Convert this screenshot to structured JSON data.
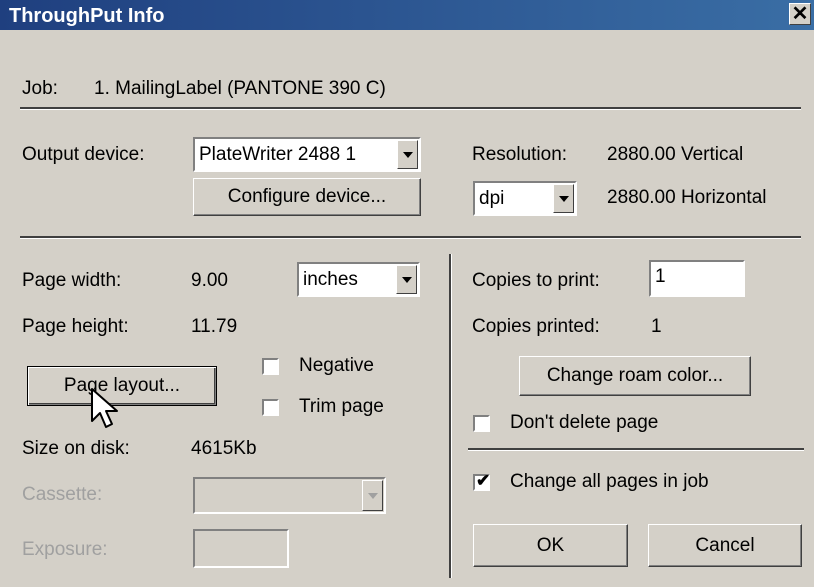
{
  "window": {
    "title": "ThroughPut Info"
  },
  "job": {
    "label": "Job:",
    "value": "1. MailingLabel (PANTONE 390 C)"
  },
  "output": {
    "label": "Output device:",
    "device": "PlateWriter 2488 1",
    "configure_label": "Configure device..."
  },
  "resolution": {
    "label": "Resolution:",
    "vertical": "2880.00 Vertical",
    "horizontal": "2880.00 Horizontal",
    "unit": "dpi"
  },
  "page": {
    "width_label": "Page width:",
    "width_value": "9.00",
    "unit": "inches",
    "height_label": "Page height:",
    "height_value": "11.79",
    "layout_label": "Page layout...",
    "negative_label": "Negative",
    "negative_checked": false,
    "trim_label": "Trim page",
    "trim_checked": false,
    "size_label": "Size on disk:",
    "size_value": "4615Kb",
    "cassette_label": "Cassette:",
    "cassette_value": "",
    "exposure_label": "Exposure:",
    "exposure_value": ""
  },
  "copies": {
    "print_label": "Copies to print:",
    "print_value": "1",
    "printed_label": "Copies printed:",
    "printed_value": "1",
    "roam_label": "Change roam color...",
    "dont_delete_label": "Don't delete page",
    "dont_delete_checked": false,
    "change_all_label": "Change all pages in job",
    "change_all_checked": true
  },
  "buttons": {
    "ok": "OK",
    "cancel": "Cancel"
  },
  "icons": {
    "close": "close-icon",
    "cursor": "mouse-pointer-icon",
    "checkmark": "checkmark-icon"
  },
  "colors": {
    "titlebar_start": "#1f3f7f",
    "titlebar_end": "#3a6ea5",
    "dialog_bg": "#d4d0c8"
  }
}
